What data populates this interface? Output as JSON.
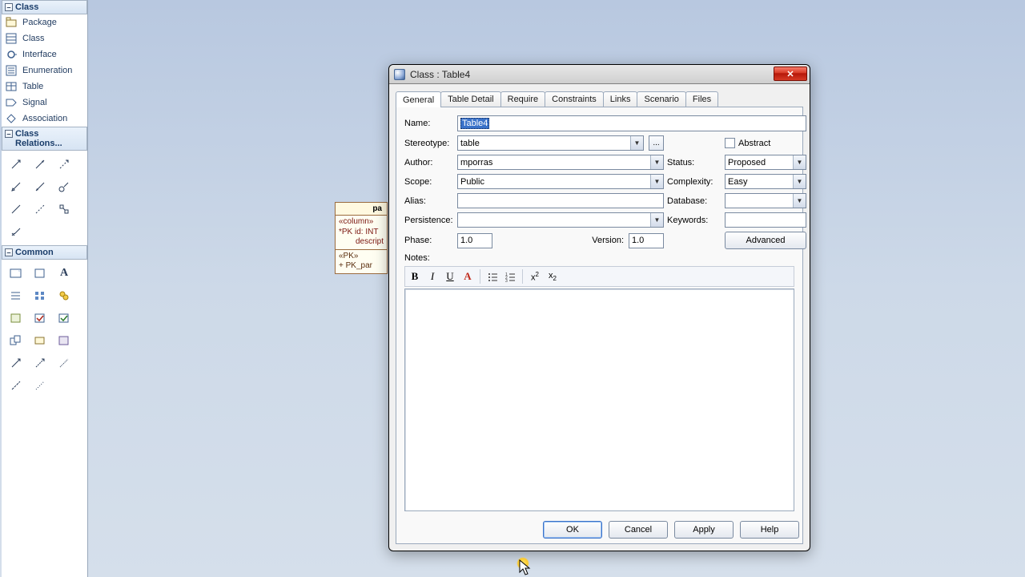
{
  "toolbox": {
    "sections": {
      "class": {
        "title": "Class",
        "items": [
          "Package",
          "Class",
          "Interface",
          "Enumeration",
          "Table",
          "Signal",
          "Association"
        ]
      },
      "relations": {
        "title": "Class Relations..."
      },
      "common": {
        "title": "Common"
      }
    },
    "icons": {
      "package": "package-icon",
      "class": "class-icon",
      "interface": "interface-icon",
      "enumeration": "enumeration-icon",
      "table": "table-icon",
      "signal": "signal-icon",
      "association": "association-icon"
    }
  },
  "canvas": {
    "box": {
      "title": "pa",
      "stereo": "«column»",
      "line1": "*PK  id:  INT",
      "line2": "descript",
      "stereo2": "«PK»",
      "line3": "+      PK_par"
    }
  },
  "dialog": {
    "title": "Class : Table4",
    "close": "✕",
    "tabs": [
      "General",
      "Table Detail",
      "Require",
      "Constraints",
      "Links",
      "Scenario",
      "Files"
    ],
    "activeTab": 0,
    "labels": {
      "name": "Name:",
      "stereotype": "Stereotype:",
      "author": "Author:",
      "scope": "Scope:",
      "alias": "Alias:",
      "persistence": "Persistence:",
      "phase": "Phase:",
      "version": "Version:",
      "notes": "Notes:",
      "abstract": "Abstract",
      "status": "Status:",
      "complexity": "Complexity:",
      "database": "Database:",
      "keywords": "Keywords:"
    },
    "fields": {
      "name": "Table4",
      "stereotype": "table",
      "author": "mporras",
      "scope": "Public",
      "alias": "",
      "persistence": "",
      "phase": "1.0",
      "version": "1.0",
      "status": "Proposed",
      "complexity": "Easy",
      "database": "",
      "keywords": "",
      "abstract": false
    },
    "buttons": {
      "advanced": "Advanced",
      "ok": "OK",
      "cancel": "Cancel",
      "apply": "Apply",
      "help": "Help",
      "ellipsis": "..."
    },
    "toolbar": [
      "bold",
      "italic",
      "underline",
      "font-color",
      "bullet-list",
      "number-list",
      "superscript",
      "subscript"
    ]
  }
}
